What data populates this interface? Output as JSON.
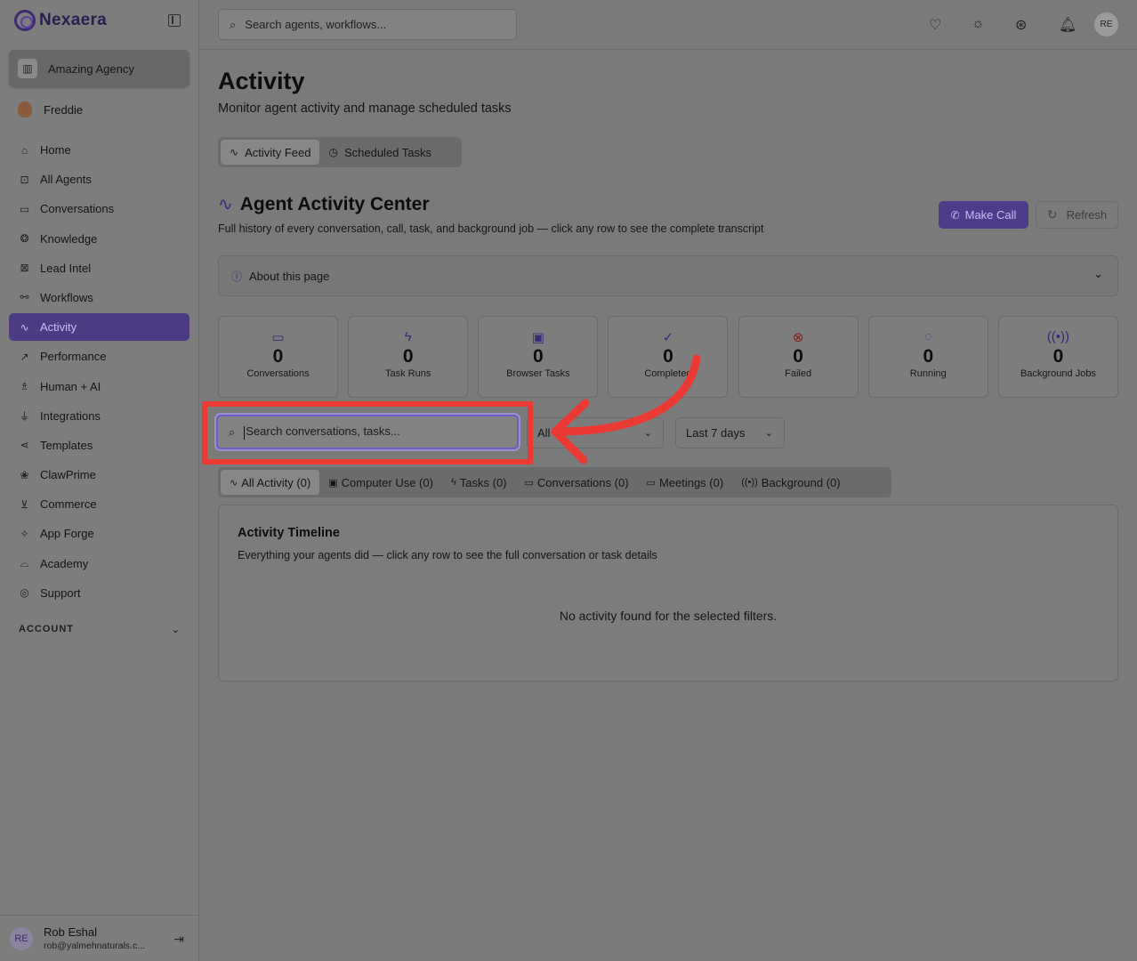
{
  "brand": {
    "name": "Nexaera"
  },
  "org": {
    "name": "Amazing Agency"
  },
  "user": {
    "name": "Freddie"
  },
  "nav": [
    {
      "label": "Home",
      "icon": "home-icon",
      "glyph": "⌂"
    },
    {
      "label": "All Agents",
      "icon": "bot-icon",
      "glyph": "⊡"
    },
    {
      "label": "Conversations",
      "icon": "message-icon",
      "glyph": "▭"
    },
    {
      "label": "Knowledge",
      "icon": "brain-icon",
      "glyph": "❂"
    },
    {
      "label": "Lead Intel",
      "icon": "contact-icon",
      "glyph": "⊠"
    },
    {
      "label": "Workflows",
      "icon": "workflow-icon",
      "glyph": "⚯"
    },
    {
      "label": "Activity",
      "icon": "activity-icon",
      "glyph": "∿"
    },
    {
      "label": "Performance",
      "icon": "trending-icon",
      "glyph": "↗"
    },
    {
      "label": "Human + AI",
      "icon": "network-icon",
      "glyph": "♗"
    },
    {
      "label": "Integrations",
      "icon": "plug-icon",
      "glyph": "⏚"
    },
    {
      "label": "Templates",
      "icon": "share-icon",
      "glyph": "⋖"
    },
    {
      "label": "ClawPrime",
      "icon": "paw-icon",
      "glyph": "❀"
    },
    {
      "label": "Commerce",
      "icon": "cart-icon",
      "glyph": "⊻"
    },
    {
      "label": "App Forge",
      "icon": "sparkles-icon",
      "glyph": "✧"
    },
    {
      "label": "Academy",
      "icon": "graduation-icon",
      "glyph": "⌓"
    },
    {
      "label": "Support",
      "icon": "help-icon",
      "glyph": "◎"
    }
  ],
  "account": {
    "label": "ACCOUNT"
  },
  "footer": {
    "initials": "RE",
    "name": "Rob Eshal",
    "email": "rob@yalmehnaturals.c..."
  },
  "topbar": {
    "search_placeholder": "Search agents, workflows...",
    "avatar": "RE"
  },
  "page": {
    "title": "Activity",
    "subtitle": "Monitor agent activity and manage scheduled tasks"
  },
  "tabs": [
    {
      "label": "Activity Feed",
      "glyph": "∿"
    },
    {
      "label": "Scheduled Tasks",
      "glyph": "◷"
    }
  ],
  "section": {
    "title": "Agent Activity Center",
    "subtitle": "Full history of every conversation, call, task, and background job — click any row to see the complete transcript",
    "make_call": "Make Call",
    "refresh": "Refresh",
    "about": "About this page"
  },
  "stats": [
    {
      "value": "0",
      "label": "Conversations",
      "icon": "message-icon",
      "glyph": "▭"
    },
    {
      "value": "0",
      "label": "Task Runs",
      "icon": "zap-icon",
      "glyph": "ϟ"
    },
    {
      "value": "0",
      "label": "Browser Tasks",
      "icon": "monitor-icon",
      "glyph": "▣"
    },
    {
      "value": "0",
      "label": "Completed",
      "icon": "check-circle-icon",
      "glyph": "✓"
    },
    {
      "value": "0",
      "label": "Failed",
      "icon": "x-circle-icon",
      "glyph": "⊗"
    },
    {
      "value": "0",
      "label": "Running",
      "icon": "loader-icon",
      "glyph": "◌"
    },
    {
      "value": "0",
      "label": "Background Jobs",
      "icon": "radio-icon",
      "glyph": "((•))"
    }
  ],
  "filters": {
    "search_placeholder": "Search conversations, tasks...",
    "status_value": "All",
    "range_value": "Last 7 days"
  },
  "filter_tabs": [
    {
      "label": "All Activity (0)",
      "glyph": "∿"
    },
    {
      "label": "Computer Use (0)",
      "glyph": "▣"
    },
    {
      "label": "Tasks (0)",
      "glyph": "ϟ"
    },
    {
      "label": "Conversations (0)",
      "glyph": "▭"
    },
    {
      "label": "Meetings (0)",
      "glyph": "▭"
    },
    {
      "label": "Background (0)",
      "glyph": "((•))"
    }
  ],
  "timeline": {
    "title": "Activity Timeline",
    "subtitle": "Everything your agents did — click any row to see the full conversation or task details",
    "empty": "No activity found for the selected filters."
  },
  "colors": {
    "accent": "#4c3b82",
    "highlight": "#ea3a33",
    "overlay": "#7a7a7a"
  }
}
